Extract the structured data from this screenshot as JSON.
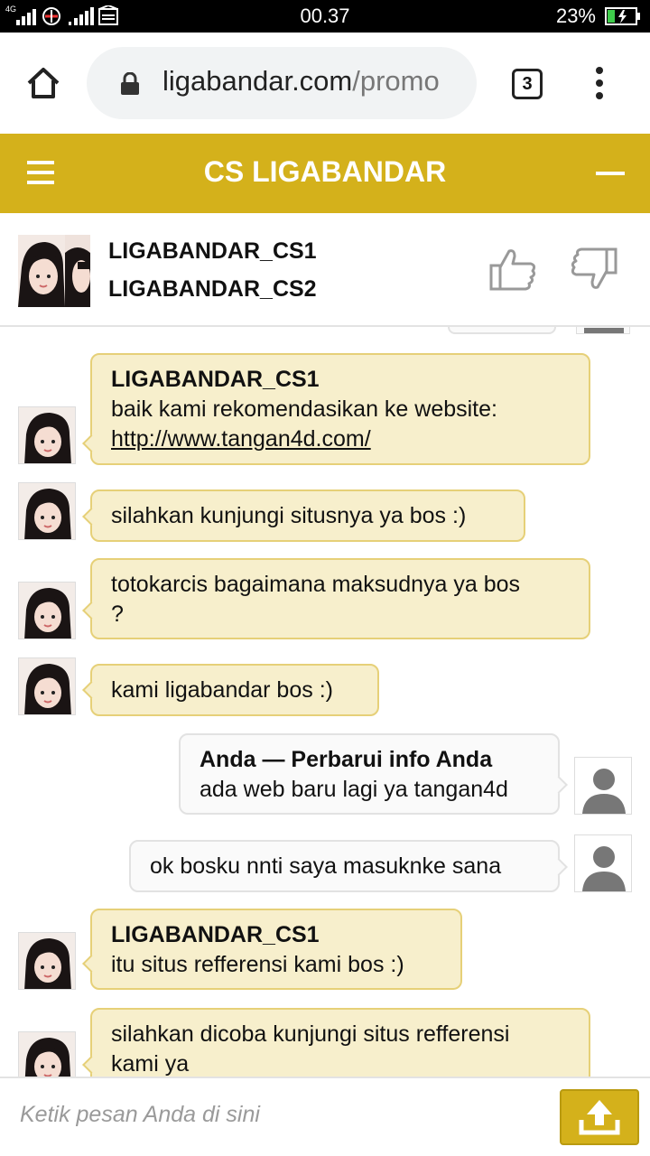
{
  "status_bar": {
    "network_tag": "4G",
    "time": "00.37",
    "battery": "23%"
  },
  "browser": {
    "url_host": "ligabandar.com",
    "url_path": "/promo",
    "tab_count": "3"
  },
  "chat_header": {
    "title": "CS LIGABANDAR"
  },
  "agents": [
    {
      "name": "LIGABANDAR_CS1"
    },
    {
      "name": "LIGABANDAR_CS2"
    }
  ],
  "messages": [
    {
      "from": "agent",
      "sender": "LIGABANDAR_CS1",
      "lines": [
        "baik kami rekomendasikan ke website:"
      ],
      "link": "http://www.tangan4d.com/"
    },
    {
      "from": "agent",
      "lines": [
        "silahkan kunjungi situsnya ya bos :)"
      ]
    },
    {
      "from": "agent",
      "lines": [
        "totokarcis bagaimana maksudnya ya bos",
        "?"
      ]
    },
    {
      "from": "agent",
      "lines": [
        "kami ligabandar bos :)"
      ]
    },
    {
      "from": "me",
      "sender": "Anda — Perbarui info Anda",
      "lines": [
        "ada web baru lagi ya tangan4d"
      ]
    },
    {
      "from": "me",
      "lines": [
        "ok bosku nnti saya masuknke sana"
      ]
    },
    {
      "from": "agent",
      "sender": "LIGABANDAR_CS1",
      "lines": [
        "itu situs refferensi kami bos :)"
      ]
    },
    {
      "from": "agent",
      "lines": [
        "silahkan dicoba kunjungi situs refferensi",
        "kami ya"
      ]
    }
  ],
  "input": {
    "placeholder": "Ketik pesan Anda di sini"
  },
  "colors": {
    "brand": "#d4b11b",
    "agent_bubble": "#f7efcc",
    "my_bubble": "#fafafa"
  },
  "icons": [
    "home-icon",
    "lock-icon",
    "menu-icon",
    "hamburger-icon",
    "minimize-icon",
    "thumbs-up-icon",
    "thumbs-down-icon",
    "upload-icon",
    "user-icon"
  ]
}
